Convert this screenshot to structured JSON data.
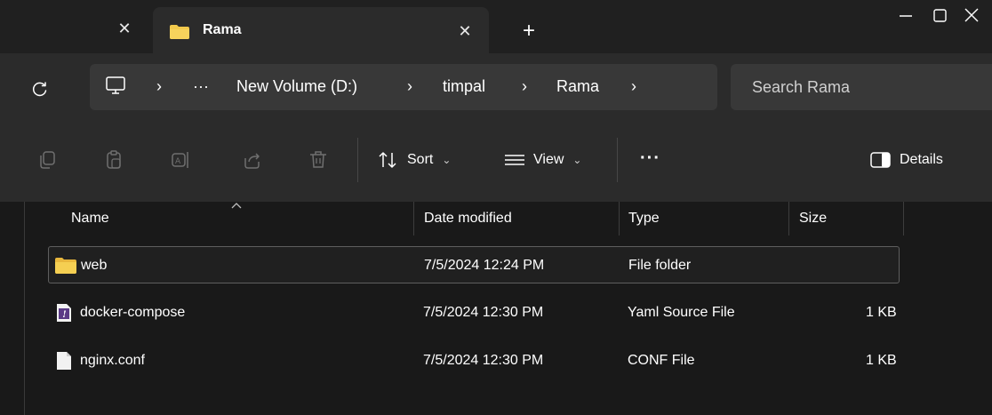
{
  "tabs": {
    "previous_close": "✕",
    "active_title": "Rama",
    "active_close": "✕",
    "new_tab": "+"
  },
  "address": {
    "breadcrumbs": [
      "New Volume (D:)",
      "timpal",
      "Rama"
    ],
    "overflow": "···",
    "separator": "›"
  },
  "search": {
    "placeholder": "Search Rama"
  },
  "toolbar": {
    "sort_label": "Sort",
    "view_label": "View",
    "more_label": "···",
    "details_label": "Details",
    "chevron": "⌄"
  },
  "columns": {
    "name": "Name",
    "date": "Date modified",
    "type": "Type",
    "size": "Size"
  },
  "files": [
    {
      "name": "web",
      "date": "7/5/2024 12:24 PM",
      "type": "File folder",
      "size": "",
      "icon": "folder-icon"
    },
    {
      "name": "docker-compose",
      "date": "7/5/2024 12:30 PM",
      "type": "Yaml Source File",
      "size": "1 KB",
      "icon": "yaml-file-icon"
    },
    {
      "name": "nginx.conf",
      "date": "7/5/2024 12:30 PM",
      "type": "CONF File",
      "size": "1 KB",
      "icon": "file-icon"
    }
  ],
  "colors": {
    "folder": "#f2c94c",
    "background": "#191919",
    "toolbar": "#2b2b2b"
  }
}
